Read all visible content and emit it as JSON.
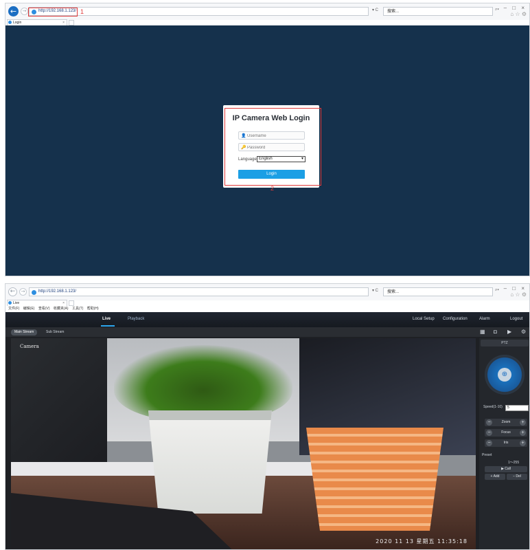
{
  "login_window": {
    "url": "http://192.168.1.123/",
    "search_placeholder": "搜索...",
    "refresh_label": "▾ C",
    "tab_title": "Login",
    "window_controls": "– □ ×",
    "toolbar_icons": "⌂ ☆ ⚙",
    "annotation_1": "1",
    "annotation_2": "2",
    "login": {
      "title": "IP Camera Web Login",
      "username_placeholder": "Username",
      "password_placeholder": "Password",
      "language_label": "Language:",
      "language_value": "English",
      "login_button": "Login"
    }
  },
  "live_window": {
    "url": "http://192.168.1.123/",
    "search_placeholder": "搜索...",
    "refresh_label": "▾ C",
    "tab_title": "Live",
    "window_controls": "– □ ×",
    "toolbar_icons": "⌂ ☆ ⚙",
    "menu": [
      "文件(F)",
      "编辑(E)",
      "查看(V)",
      "收藏夹(A)",
      "工具(T)",
      "帮助(H)"
    ],
    "nav": {
      "live": "Live",
      "playback": "Playback",
      "local_setup": "Local Setup",
      "configuration": "Configuration",
      "alarm": "Alarm",
      "logout": "Logout"
    },
    "streams": {
      "main": "Main Stream",
      "sub": "Sub Stream"
    },
    "tool_icons": [
      "grid-icon",
      "camera-icon",
      "record-icon",
      "settings-icon"
    ],
    "video": {
      "camera_label": "Camera",
      "osd_time": "2020 11 13  星期五  11:35:18"
    },
    "ptz": {
      "header": "PTZ",
      "speed_label": "Speed(1-10)",
      "speed_value": "5",
      "zoom": "Zoom",
      "focus": "Focus",
      "iris": "Iris",
      "preset_label": "Preset",
      "preset_range": "1～255",
      "call": "Call",
      "add": "Add",
      "del": "Del"
    }
  },
  "colors": {
    "login_bg": "#15314c",
    "accent": "#1b9fe5",
    "annotation": "#e03b3b",
    "live_bg": "#1e2024"
  }
}
